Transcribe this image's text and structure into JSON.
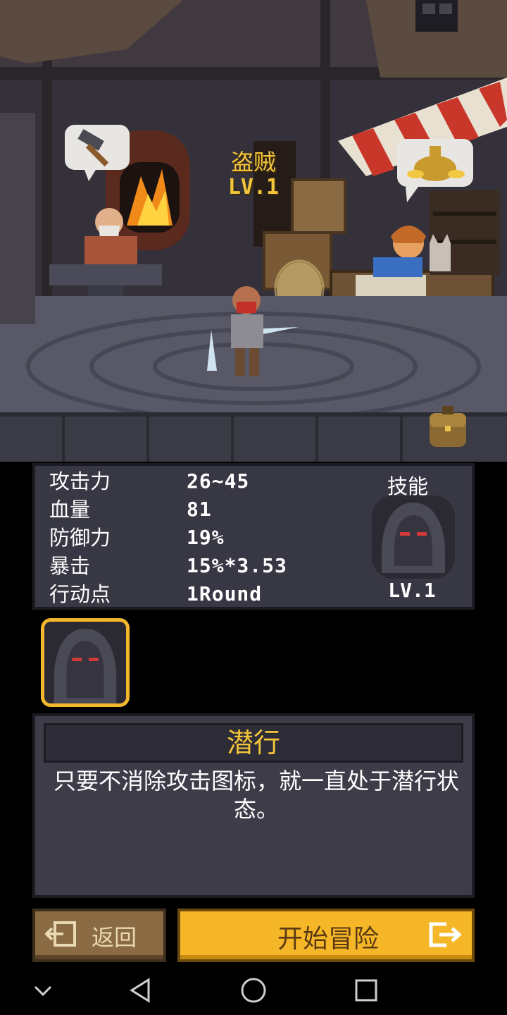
{
  "character": {
    "name": "盗贼",
    "level": "LV.1"
  },
  "stats": [
    {
      "label": "攻击力",
      "value": "26~45"
    },
    {
      "label": "血量",
      "value": "81"
    },
    {
      "label": "防御力",
      "value": "19%"
    },
    {
      "label": "暴击",
      "value": "15%*3.53"
    },
    {
      "label": "行动点",
      "value": "1Round"
    }
  ],
  "skill": {
    "title": "技能",
    "level": "LV.1",
    "icon": "hooded-figure-icon"
  },
  "selected_skill": {
    "name": "潜行",
    "description": "只要不消除攻击图标，就一直处于潜行状态。",
    "icon": "hooded-figure-icon"
  },
  "buttons": {
    "back_label": "返回",
    "start_label": "开始冒险"
  },
  "colors": {
    "accent_gold": "#f3c53a",
    "panel": "#383744",
    "start_button": "#f5b728",
    "back_button": "#8b6b43"
  },
  "nav_icons": [
    "chevron-down-icon",
    "back-triangle-icon",
    "home-circle-icon",
    "recents-square-icon"
  ]
}
